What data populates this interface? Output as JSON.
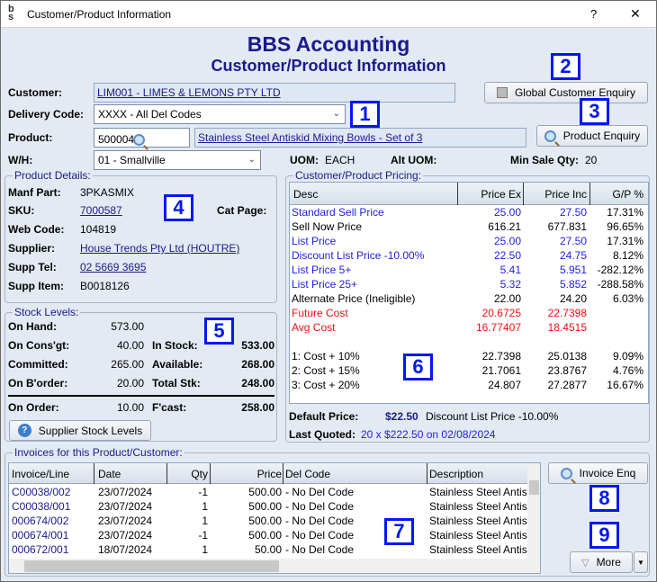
{
  "window": {
    "title": "Customer/Product Information",
    "help": "?",
    "close": "✕"
  },
  "header": {
    "title": "BBS Accounting",
    "subtitle": "Customer/Product Information"
  },
  "form": {
    "customer_label": "Customer:",
    "customer_value": "LIM001 - LIMES & LEMONS PTY LTD",
    "delivery_label": "Delivery Code:",
    "delivery_value": "XXXX - All Del Codes",
    "product_label": "Product:",
    "product_code": "500004",
    "product_desc": "Stainless Steel Antiskid Mixing Bowls - Set of 3",
    "wh_label": "W/H:",
    "wh_value": "01 - Smallville",
    "uom_label": "UOM:",
    "uom_value": "EACH",
    "alt_uom_label": "Alt UOM:",
    "min_qty_label": "Min Sale Qty:",
    "min_qty_value": "20",
    "global_enquiry": "Global Customer Enquiry",
    "product_enquiry": "Product Enquiry"
  },
  "callouts": [
    "1",
    "2",
    "3",
    "4",
    "5",
    "6",
    "7",
    "8",
    "9"
  ],
  "product_details": {
    "title": "Product Details:",
    "manf_label": "Manf Part:",
    "manf": "3PKASMIX",
    "sku_label": "SKU:",
    "sku": "7000587",
    "cat_label": "Cat Page:",
    "web_label": "Web Code:",
    "web": "104819",
    "supplier_label": "Supplier:",
    "supplier": "House Trends Pty Ltd (HOUTRE)",
    "tel_label": "Supp Tel:",
    "tel": "02 5669 3695",
    "item_label": "Supp Item:",
    "item": "B0018126"
  },
  "stock": {
    "title": "Stock Levels:",
    "on_hand_label": "On Hand:",
    "on_hand": "573.00",
    "cons_label": "On Cons'gt:",
    "cons": "40.00",
    "committed_label": "Committed:",
    "committed": "265.00",
    "border_label": "On B'order:",
    "border": "20.00",
    "in_stock_label": "In Stock:",
    "in_stock": "533.00",
    "available_label": "Available:",
    "available": "268.00",
    "total_label": "Total Stk:",
    "total": "248.00",
    "on_order_label": "On Order:",
    "on_order": "10.00",
    "fcast_label": "F'cast:",
    "fcast": "258.00",
    "supplier_button": "Supplier Stock Levels"
  },
  "pricing": {
    "title": "Customer/Product Pricing:",
    "headers": [
      "Desc",
      "Price Ex",
      "Price Inc",
      "G/P %"
    ],
    "rows": [
      {
        "desc": "Standard Sell Price",
        "ex": "25.00",
        "inc": "27.50",
        "gp": "17.31%",
        "color": "blue"
      },
      {
        "desc": "Sell Now Price",
        "ex": "616.21",
        "inc": "677.831",
        "gp": "96.65%",
        "color": "black"
      },
      {
        "desc": "List Price",
        "ex": "25.00",
        "inc": "27.50",
        "gp": "17.31%",
        "color": "blue"
      },
      {
        "desc": "Discount List Price -10.00%",
        "ex": "22.50",
        "inc": "24.75",
        "gp": "8.12%",
        "color": "blue"
      },
      {
        "desc": "List Price 5+",
        "ex": "5.41",
        "inc": "5.951",
        "gp": "-282.12%",
        "color": "blue"
      },
      {
        "desc": "List Price 25+",
        "ex": "5.32",
        "inc": "5.852",
        "gp": "-288.58%",
        "color": "blue"
      },
      {
        "desc": "Alternate Price (Ineligible)",
        "ex": "22.00",
        "inc": "24.20",
        "gp": "6.03%",
        "color": "black"
      },
      {
        "desc": "Future Cost",
        "ex": "20.6725",
        "inc": "22.7398",
        "gp": "",
        "color": "red"
      },
      {
        "desc": "Avg Cost",
        "ex": "16.77407",
        "inc": "18.4515",
        "gp": "",
        "color": "red"
      },
      {
        "desc": "",
        "ex": "",
        "inc": "",
        "gp": "",
        "color": "black"
      },
      {
        "desc": "1: Cost + 10%",
        "ex": "22.7398",
        "inc": "25.0138",
        "gp": "9.09%",
        "color": "black"
      },
      {
        "desc": "2: Cost + 15%",
        "ex": "21.7061",
        "inc": "23.8767",
        "gp": "4.76%",
        "color": "black"
      },
      {
        "desc": "3: Cost + 20%",
        "ex": "24.807",
        "inc": "27.2877",
        "gp": "16.67%",
        "color": "black"
      }
    ],
    "default_label": "Default Price:",
    "default_value": "$22.50",
    "default_desc": "Discount List Price -10.00%",
    "quoted_label": "Last Quoted:",
    "quoted_value": "20 x $222.50 on 02/08/2024"
  },
  "invoices": {
    "title": "Invoices for this Product/Customer:",
    "headers": [
      "Invoice/Line",
      "Date",
      "Qty",
      "Price",
      "Del Code",
      "Description"
    ],
    "rows": [
      [
        "C00038/002",
        "23/07/2024",
        "-1",
        "500.00",
        "- No Del Code",
        "Stainless Steel Antis"
      ],
      [
        "C00038/001",
        "23/07/2024",
        "1",
        "500.00",
        "- No Del Code",
        "Stainless Steel Antis"
      ],
      [
        "000674/002",
        "23/07/2024",
        "1",
        "500.00",
        "- No Del Code",
        "Stainless Steel Antis"
      ],
      [
        "000674/001",
        "23/07/2024",
        "-1",
        "500.00",
        "- No Del Code",
        "Stainless Steel Antis"
      ],
      [
        "000672/001",
        "18/07/2024",
        "1",
        "50.00",
        "- No Del Code",
        "Stainless Steel Antis"
      ]
    ],
    "invoice_enq": "Invoice Enq",
    "more": "More"
  },
  "colors": {
    "blue": "#1e1ee6",
    "red": "#f01010",
    "black": "#000000",
    "navy": "#1a1a8c"
  }
}
